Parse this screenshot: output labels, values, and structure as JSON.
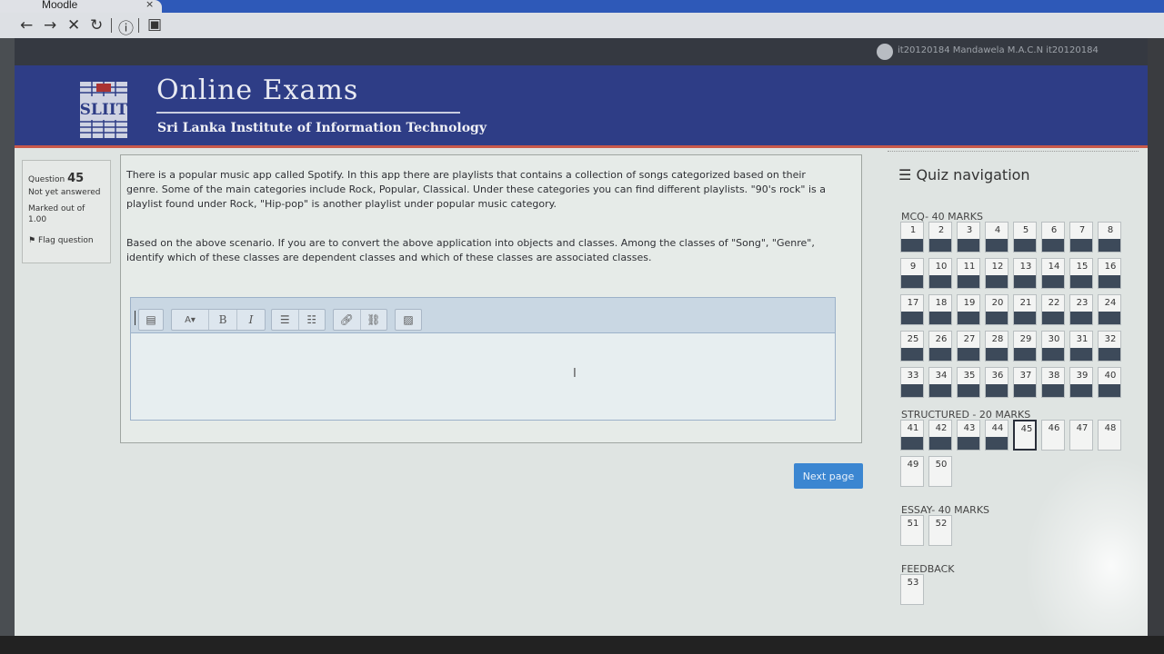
{
  "browser": {
    "tab_title": "Moodle",
    "tab_close": "×",
    "nav_icons": [
      "back-arrow-icon",
      "forward-arrow-icon",
      "stop-icon",
      "reload-icon",
      "info-icon",
      "reader-icon"
    ]
  },
  "user": {
    "name": "it20120184 Mandawela M.A.C.N it20120184"
  },
  "banner": {
    "logo_text": "SLIIT",
    "title": "Online Exams",
    "subtitle": "Sri Lanka Institute of Information Technology"
  },
  "question_info": {
    "label": "Question",
    "number": "45",
    "state": "Not yet answered",
    "marked_out_of": "Marked out of",
    "marks": "1.00",
    "flag": "Flag question"
  },
  "question": {
    "para1": "There is a popular music app called Spotify. In this app there are playlists that contains a collection of songs categorized based on their genre. Some of the main categories include Rock, Popular, Classical. Under these categories you can find different playlists. \"90's rock\" is a playlist found under Rock, \"Hip-pop\" is another playlist under popular music category.",
    "para2": "Based on the above scenario. If you are to convert the above application into objects and classes. Among the classes of \"Song\", \"Genre\", identify which of these classes are dependent classes and which of these classes are associated classes."
  },
  "editor": {
    "font_btn": "A",
    "bold": "B",
    "italic": "I",
    "answer": ""
  },
  "next_button": "Next page",
  "quiz_navigation": {
    "title": "Quiz navigation",
    "sections": [
      {
        "title": "MCQ- 40 MARKS",
        "questions": [
          "1",
          "2",
          "3",
          "4",
          "5",
          "6",
          "7",
          "8",
          "9",
          "10",
          "11",
          "12",
          "13",
          "14",
          "15",
          "16",
          "17",
          "18",
          "19",
          "20",
          "21",
          "22",
          "23",
          "24",
          "25",
          "26",
          "27",
          "28",
          "29",
          "30",
          "31",
          "32",
          "33",
          "34",
          "35",
          "36",
          "37",
          "38",
          "39",
          "40"
        ]
      },
      {
        "title": "STRUCTURED - 20 MARKS",
        "questions": [
          "41",
          "42",
          "43",
          "44",
          "45",
          "46",
          "47",
          "48",
          "49",
          "50"
        ]
      },
      {
        "title": "ESSAY- 40 MARKS",
        "questions": [
          "51",
          "52"
        ]
      },
      {
        "title": "FEEDBACK",
        "questions": [
          "53"
        ]
      }
    ],
    "answered": [
      "1",
      "2",
      "3",
      "4",
      "5",
      "6",
      "7",
      "8",
      "9",
      "10",
      "11",
      "12",
      "13",
      "14",
      "15",
      "16",
      "17",
      "18",
      "19",
      "20",
      "21",
      "22",
      "23",
      "24",
      "25",
      "26",
      "27",
      "28",
      "29",
      "30",
      "31",
      "32",
      "33",
      "34",
      "35",
      "36",
      "37",
      "38",
      "39",
      "40",
      "41",
      "42",
      "43",
      "44"
    ],
    "current": "45"
  },
  "colors": {
    "banner": "#2e3d86",
    "accent_line": "#c9594a",
    "next_button": "#3b86d1",
    "answered_bar": "#3d4a5a"
  }
}
